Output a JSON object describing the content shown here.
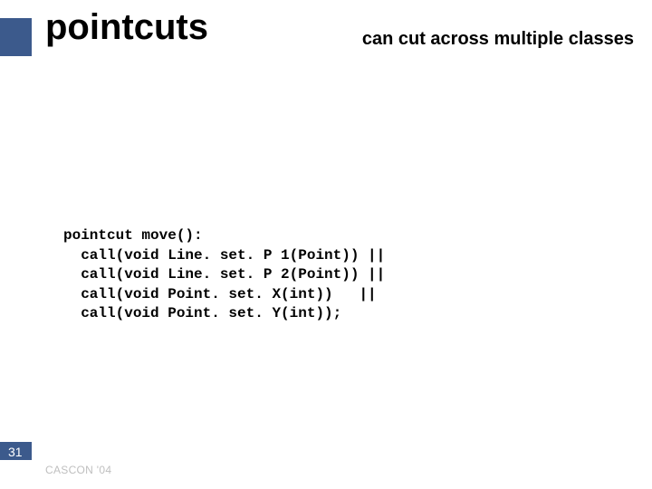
{
  "header": {
    "title": "pointcuts",
    "subtitle": "can cut across multiple classes"
  },
  "code": {
    "keyword": "pointcut",
    "signature": " move():",
    "lines": [
      "  call(void Line. set. P 1(Point)) ||",
      "  call(void Line. set. P 2(Point)) ||",
      "  call(void Point. set. X(int))   ||",
      "  call(void Point. set. Y(int));"
    ]
  },
  "footer": {
    "slide_number": "31",
    "conference": "CASCON '04"
  }
}
